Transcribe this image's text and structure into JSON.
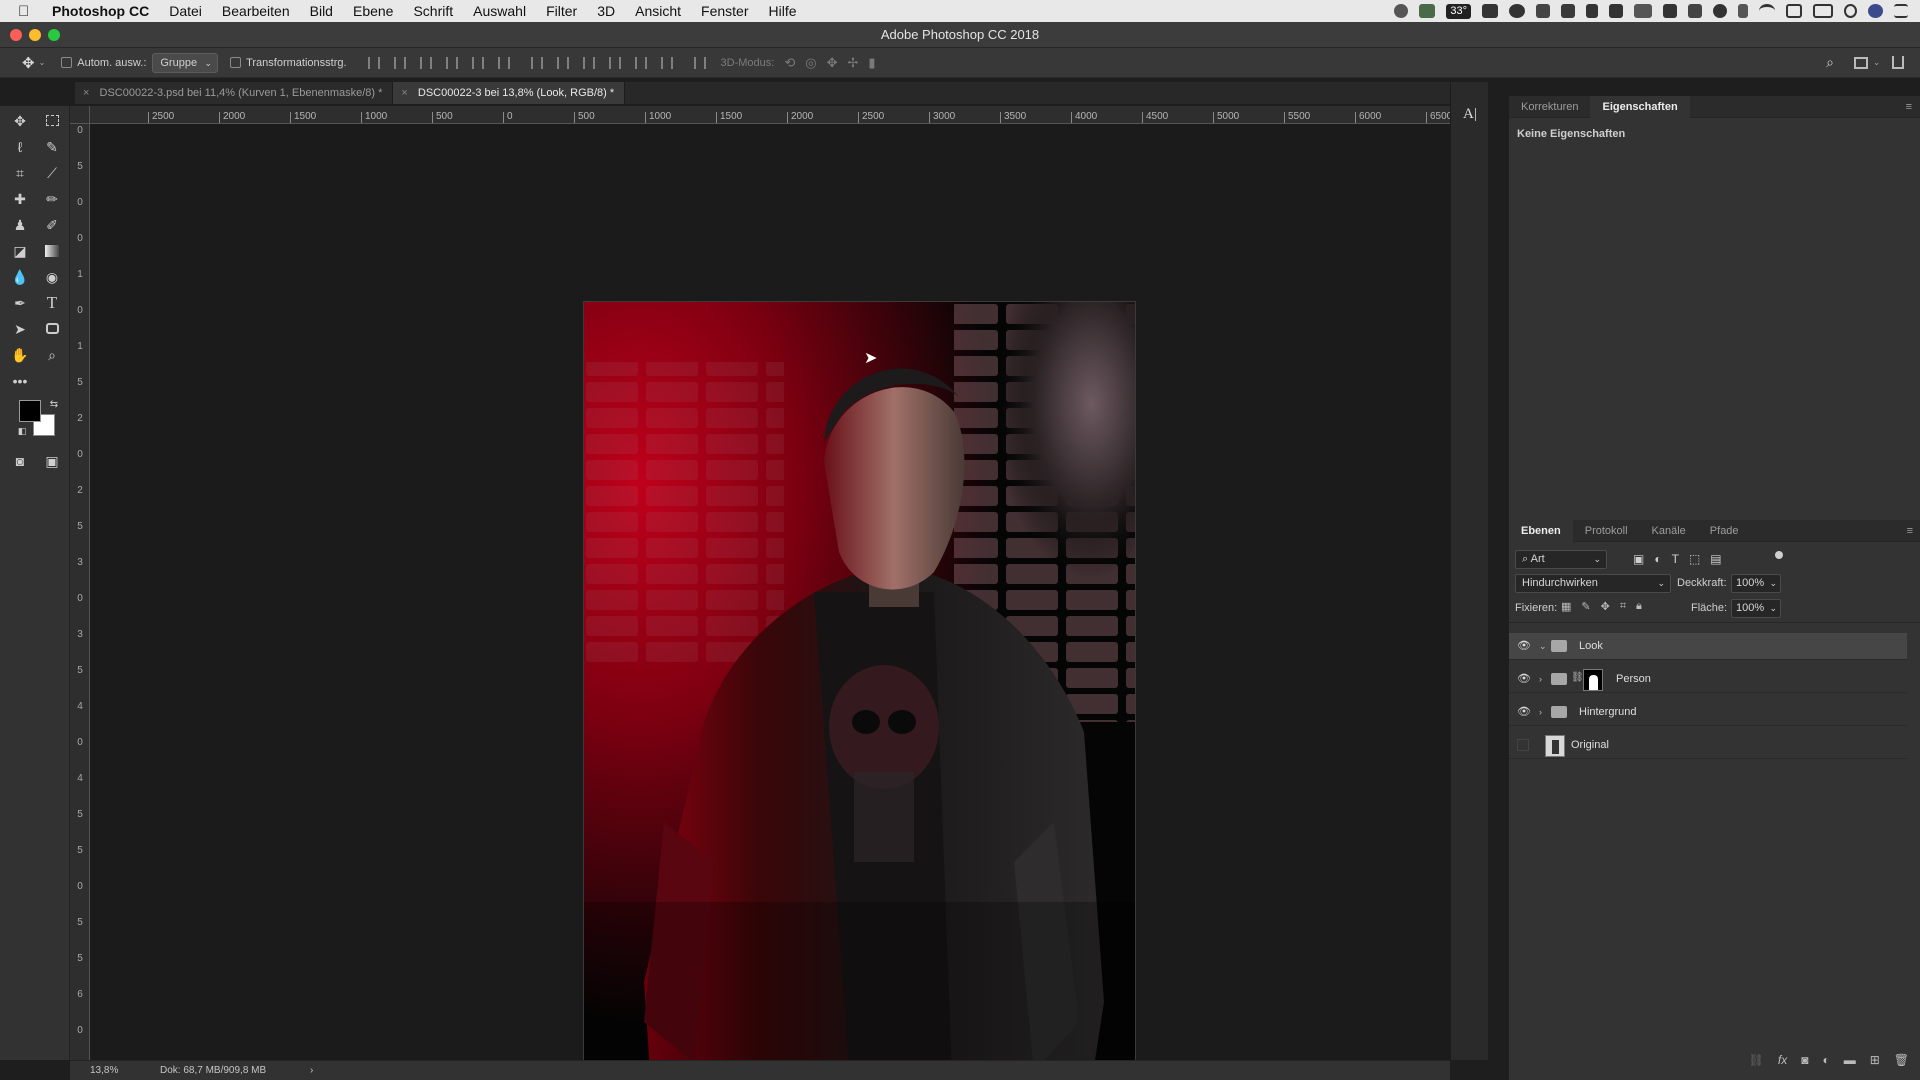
{
  "menubar": {
    "apple": "",
    "app_name": "Photoshop CC",
    "items": [
      "Datei",
      "Bearbeiten",
      "Bild",
      "Ebene",
      "Schrift",
      "Auswahl",
      "Filter",
      "3D",
      "Ansicht",
      "Fenster",
      "Hilfe"
    ],
    "battery_badge": "33°"
  },
  "window": {
    "title": "Adobe Photoshop CC 2018"
  },
  "options": {
    "auto_select_label": "Autom. ausw.:",
    "auto_select_value": "Gruppe",
    "transform_label": "Transformationsstrg.",
    "mode_3d_label": "3D-Modus:"
  },
  "tabs": [
    {
      "label": "DSC00022-3.psd bei 11,4% (Kurven 1, Ebenenmaske/8) *",
      "active": false
    },
    {
      "label": "DSC00022-3 bei 13,8% (Look, RGB/8) *",
      "active": true
    }
  ],
  "ruler_h": [
    "2500",
    "2000",
    "1500",
    "1000",
    "500",
    "0",
    "500",
    "1000",
    "1500",
    "2000",
    "2500",
    "3000",
    "3500",
    "4000",
    "4500",
    "5000",
    "5500",
    "6000",
    "6500"
  ],
  "ruler_v": [
    "0",
    "5",
    "0",
    "0",
    "1",
    "0",
    "1",
    "5",
    "2",
    "0",
    "2",
    "5",
    "3",
    "0",
    "3",
    "5",
    "4",
    "0",
    "4",
    "5",
    "5",
    "0",
    "5",
    "5",
    "6",
    "0"
  ],
  "status": {
    "zoom": "13,8%",
    "doc": "Dok: 68,7 MB/909,8 MB",
    "arrow": "›"
  },
  "properties_panel": {
    "tabs": [
      "Korrekturen",
      "Eigenschaften"
    ],
    "active_tab": "Eigenschaften",
    "message": "Keine Eigenschaften"
  },
  "layers_panel": {
    "tabs": [
      "Ebenen",
      "Protokoll",
      "Kanäle",
      "Pfade"
    ],
    "active_tab": "Ebenen",
    "filter_label": "Art",
    "blend_mode": "Hindurchwirken",
    "opacity_label": "Deckkraft:",
    "opacity_value": "100%",
    "lock_label": "Fixieren:",
    "fill_label": "Fläche:",
    "fill_value": "100%",
    "layers": [
      {
        "name": "Look",
        "type": "group",
        "visible": true,
        "expanded": true,
        "selected": true
      },
      {
        "name": "Person",
        "type": "group-mask",
        "visible": true,
        "expanded": false,
        "selected": false
      },
      {
        "name": "Hintergrund",
        "type": "group",
        "visible": true,
        "expanded": false,
        "selected": false
      },
      {
        "name": "Original",
        "type": "smart",
        "visible": false,
        "expanded": false,
        "selected": false
      }
    ]
  },
  "colors": {
    "accent_red": "#c0001c",
    "panel_bg": "#333333",
    "canvas_bg": "#1b1b1b"
  }
}
